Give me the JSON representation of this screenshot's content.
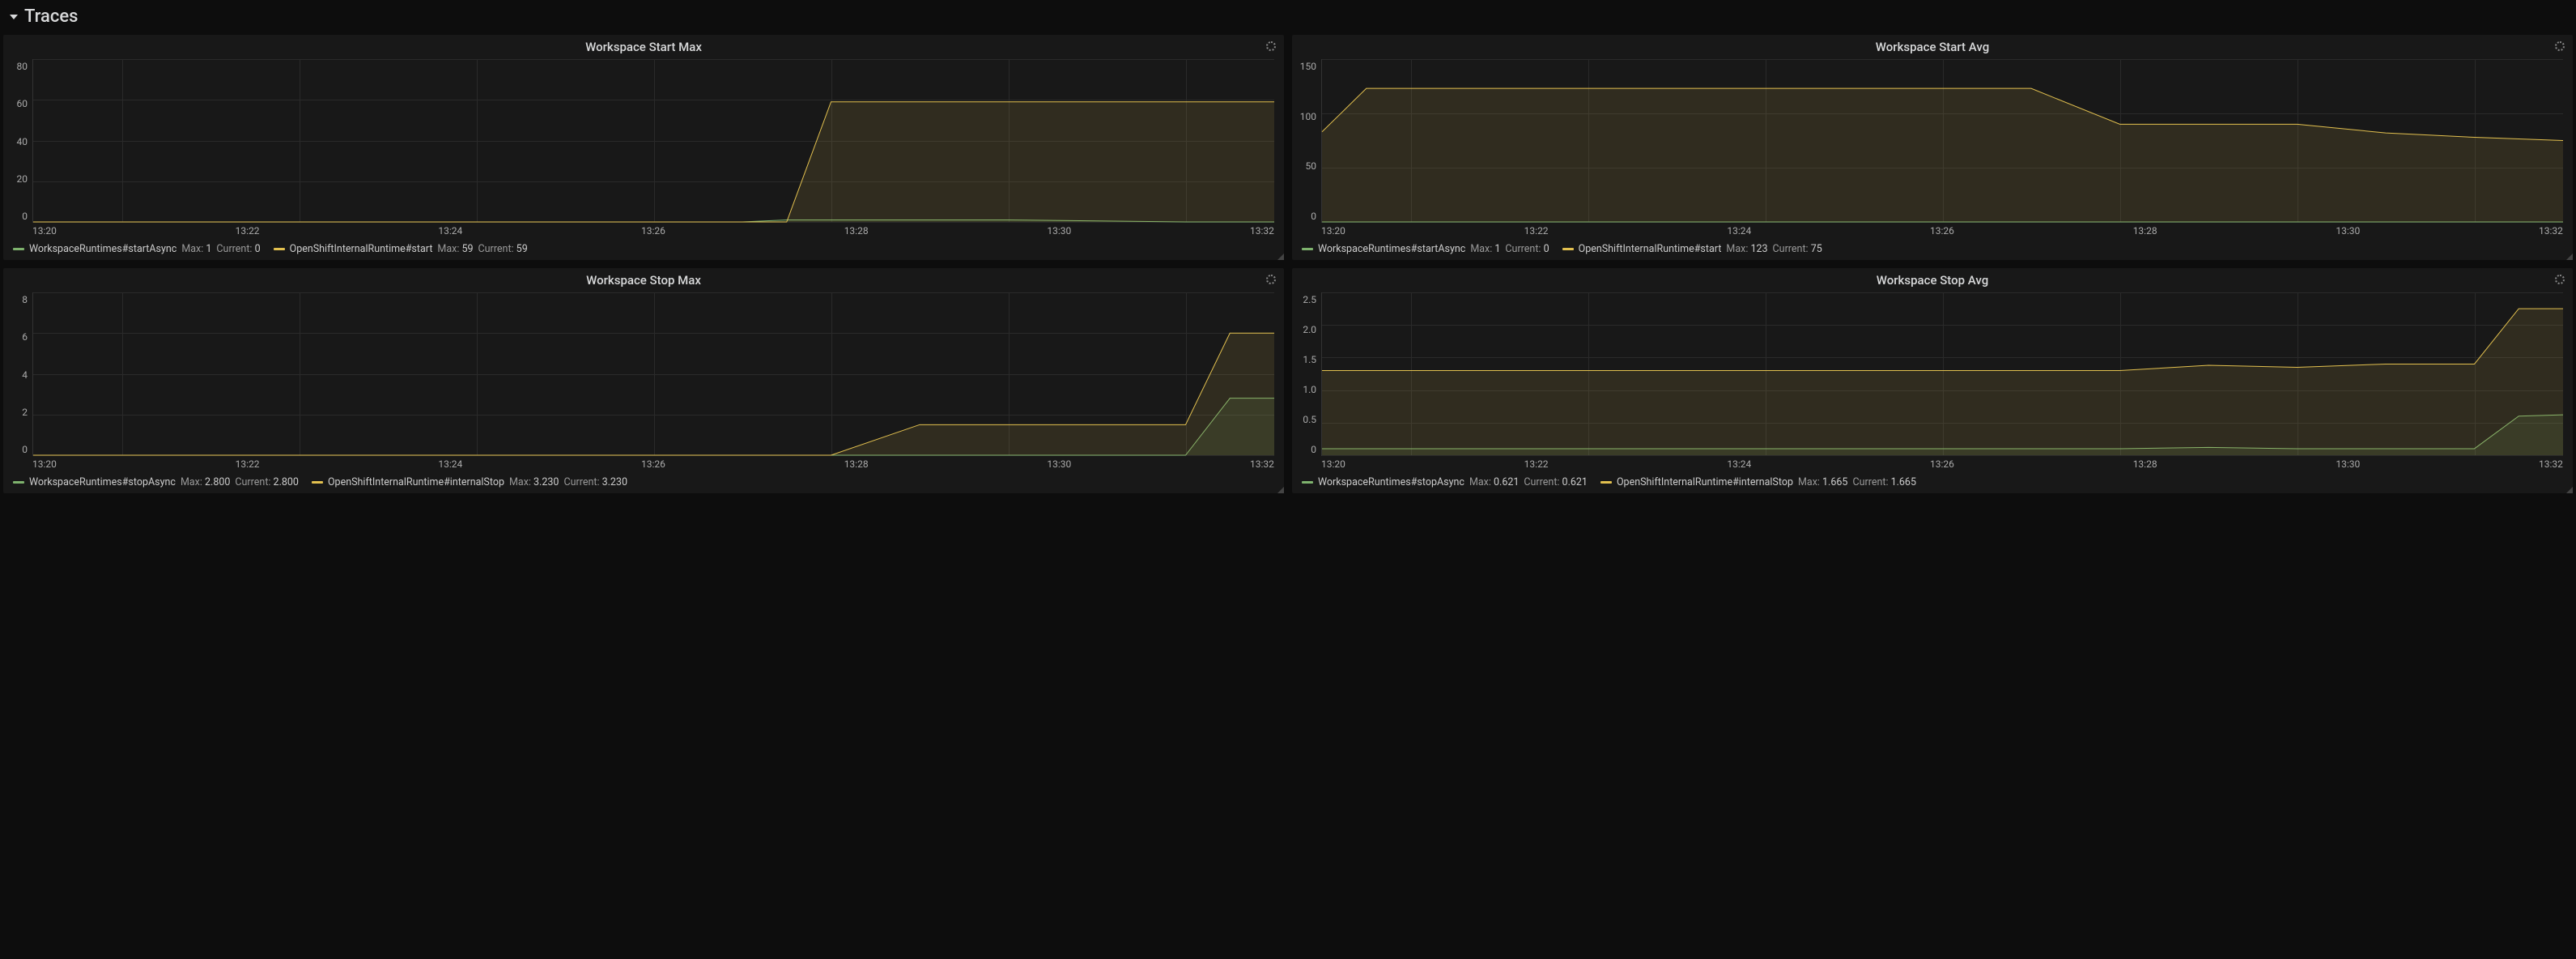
{
  "section_title": "Traces",
  "colors": {
    "green": "#7eb26d",
    "yellow": "#e2c04f"
  },
  "xticks": [
    "13:20",
    "13:22",
    "13:24",
    "13:26",
    "13:28",
    "13:30",
    "13:32"
  ],
  "panels": [
    {
      "id": "ws-start-max",
      "title": "Workspace Start Max",
      "yticks": [
        "80",
        "60",
        "40",
        "20",
        "0"
      ],
      "ymax": 80,
      "series": [
        {
          "name": "WorkspaceRuntimes#startAsync",
          "color": "green",
          "max": "1",
          "current": "0"
        },
        {
          "name": "OpenShiftInternalRuntime#start",
          "color": "yellow",
          "max": "59",
          "current": "59"
        }
      ]
    },
    {
      "id": "ws-start-avg",
      "title": "Workspace Start Avg",
      "yticks": [
        "150",
        "100",
        "50",
        "0"
      ],
      "ymax": 150,
      "series": [
        {
          "name": "WorkspaceRuntimes#startAsync",
          "color": "green",
          "max": "1",
          "current": "0"
        },
        {
          "name": "OpenShiftInternalRuntime#start",
          "color": "yellow",
          "max": "123",
          "current": "75"
        }
      ]
    },
    {
      "id": "ws-stop-max",
      "title": "Workspace Stop Max",
      "yticks": [
        "8",
        "6",
        "4",
        "2",
        "0"
      ],
      "ymax": 8,
      "series": [
        {
          "name": "WorkspaceRuntimes#stopAsync",
          "color": "green",
          "max": "2.800",
          "current": "2.800"
        },
        {
          "name": "OpenShiftInternalRuntime#internalStop",
          "color": "yellow",
          "max": "3.230",
          "current": "3.230"
        }
      ]
    },
    {
      "id": "ws-stop-avg",
      "title": "Workspace Stop Avg",
      "yticks": [
        "2.5",
        "2.0",
        "1.5",
        "1.0",
        "0.5",
        "0"
      ],
      "ymax": 2.5,
      "series": [
        {
          "name": "WorkspaceRuntimes#stopAsync",
          "color": "green",
          "max": "0.621",
          "current": "0.621"
        },
        {
          "name": "OpenShiftInternalRuntime#internalStop",
          "color": "yellow",
          "max": "1.665",
          "current": "1.665"
        }
      ]
    }
  ],
  "chart_data": [
    {
      "type": "line",
      "title": "Workspace Start Max",
      "xlabel": "",
      "ylabel": "",
      "ylim": [
        0,
        80
      ],
      "x": [
        "13:19",
        "13:20",
        "13:22",
        "13:24",
        "13:26",
        "13:27",
        "13:27.5",
        "13:28",
        "13:30",
        "13:32",
        "13:33"
      ],
      "series": [
        {
          "name": "WorkspaceRuntimes#startAsync",
          "values": [
            0,
            0,
            0,
            0,
            0,
            0,
            1,
            1,
            1,
            0,
            0
          ]
        },
        {
          "name": "OpenShiftInternalRuntime#start",
          "values": [
            0,
            0,
            0,
            0,
            0,
            0,
            0,
            59,
            59,
            59,
            59
          ]
        }
      ]
    },
    {
      "type": "line",
      "title": "Workspace Start Avg",
      "xlabel": "",
      "ylabel": "",
      "ylim": [
        0,
        150
      ],
      "x": [
        "13:19",
        "13:19.5",
        "13:20",
        "13:22",
        "13:24",
        "13:26",
        "13:27",
        "13:28",
        "13:30",
        "13:31",
        "13:32",
        "13:33"
      ],
      "series": [
        {
          "name": "WorkspaceRuntimes#startAsync",
          "values": [
            0,
            0,
            0,
            0,
            0,
            0,
            0,
            0,
            0,
            0,
            0,
            0
          ]
        },
        {
          "name": "OpenShiftInternalRuntime#start",
          "values": [
            83,
            123,
            123,
            123,
            123,
            123,
            123,
            90,
            90,
            82,
            78,
            75
          ]
        }
      ]
    },
    {
      "type": "line",
      "title": "Workspace Stop Max",
      "xlabel": "",
      "ylabel": "",
      "ylim": [
        0,
        8
      ],
      "x": [
        "13:19",
        "13:20",
        "13:22",
        "13:24",
        "13:26",
        "13:28",
        "13:29",
        "13:30",
        "13:31",
        "13:32",
        "13:32.5",
        "13:33"
      ],
      "series": [
        {
          "name": "WorkspaceRuntimes#stopAsync",
          "values": [
            0,
            0,
            0,
            0,
            0,
            0,
            0,
            0,
            0,
            0,
            2.8,
            2.8
          ]
        },
        {
          "name": "OpenShiftInternalRuntime#internalStop",
          "values": [
            0,
            0,
            0,
            0,
            0,
            0,
            1.5,
            1.5,
            1.5,
            1.5,
            6.0,
            6.0
          ]
        }
      ]
    },
    {
      "type": "line",
      "title": "Workspace Stop Avg",
      "xlabel": "",
      "ylabel": "",
      "ylim": [
        0,
        2.5
      ],
      "x": [
        "13:19",
        "13:20",
        "13:22",
        "13:24",
        "13:26",
        "13:28",
        "13:29",
        "13:30",
        "13:31",
        "13:32",
        "13:32.5",
        "13:33"
      ],
      "series": [
        {
          "name": "WorkspaceRuntimes#stopAsync",
          "values": [
            0.1,
            0.1,
            0.1,
            0.1,
            0.1,
            0.1,
            0.12,
            0.1,
            0.1,
            0.1,
            0.6,
            0.621
          ]
        },
        {
          "name": "OpenShiftInternalRuntime#internalStop",
          "values": [
            1.3,
            1.3,
            1.3,
            1.3,
            1.3,
            1.3,
            1.38,
            1.35,
            1.4,
            1.4,
            2.25,
            2.25
          ]
        }
      ]
    }
  ]
}
